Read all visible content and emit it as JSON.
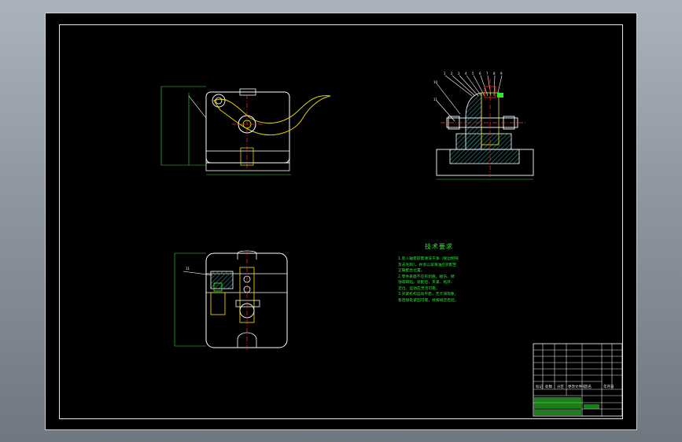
{
  "drawing": {
    "tech_requirements_title": "技术要求",
    "tech_requirements": [
      "1.装入轴套前需清洗干净（锐边倒钝",
      "及去毛刺），并涂以润滑油后装配至",
      "正确配合位置。",
      "2.零件表面不应有划痕、碰伤、锈",
      "蚀等缺陷。装配后，夹紧、松开、",
      "定位、运动应灵活可靠。",
      "3.夹紧机构运动平稳，无卡滞现象，",
      "各连接处紧固可靠，并按规定检验。"
    ],
    "title_block": {
      "scale_row": [
        "标记",
        "处数",
        "分区",
        "更改文件号",
        "签名",
        "年月日"
      ]
    }
  },
  "colors": {
    "sheet_bg": "#000000",
    "line_white": "#ffffff",
    "line_yellow": "#e6d200",
    "line_green": "#2fe62f",
    "line_red": "#ff2a2a",
    "line_cyan": "#2ad8e6",
    "hatch": "#2b7f7f"
  }
}
